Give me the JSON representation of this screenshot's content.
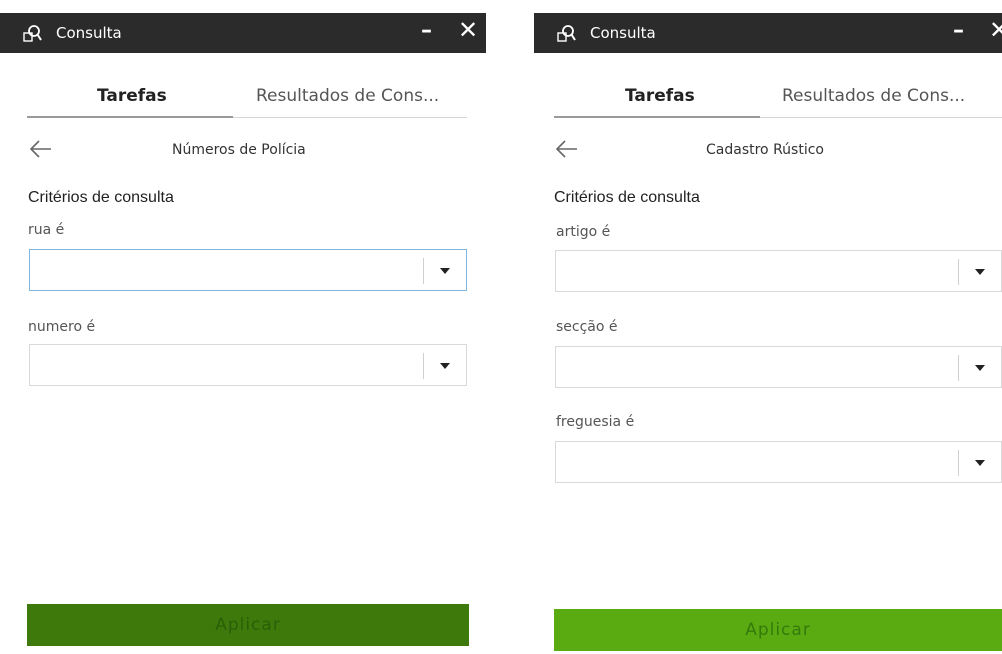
{
  "panels": [
    {
      "window": {
        "title": "Consulta",
        "minimize_glyph": "–",
        "close_glyph": "✕"
      },
      "tabs": [
        {
          "label": "Tarefas",
          "active": true
        },
        {
          "label": "Resultados de Cons...",
          "active": false
        }
      ],
      "query_name": "Números de Polícia",
      "criteria_heading": "Critérios de consulta",
      "fields": [
        {
          "label": "rua é",
          "value": "",
          "focused": true
        },
        {
          "label": "numero é",
          "value": "",
          "focused": false
        }
      ],
      "apply_label": "Aplicar",
      "apply_color": "#3d7a0b"
    },
    {
      "window": {
        "title": "Consulta",
        "minimize_glyph": "–",
        "close_glyph": "✕"
      },
      "tabs": [
        {
          "label": "Tarefas",
          "active": true
        },
        {
          "label": "Resultados de Cons...",
          "active": false
        }
      ],
      "query_name": "Cadastro Rústico",
      "criteria_heading": "Critérios de consulta",
      "fields": [
        {
          "label": "artigo é",
          "value": ""
        },
        {
          "label": "secção é",
          "value": ""
        },
        {
          "label": "freguesia é",
          "value": ""
        }
      ],
      "apply_label": "Aplicar",
      "apply_color": "#5aab12"
    }
  ],
  "icons": {
    "app": "query-search-icon",
    "back": "arrow-left-icon",
    "dropdown": "caret-down-icon"
  },
  "colors": {
    "titlebar_bg": "#2b2b2b",
    "focus_border": "#7fb6e0"
  }
}
